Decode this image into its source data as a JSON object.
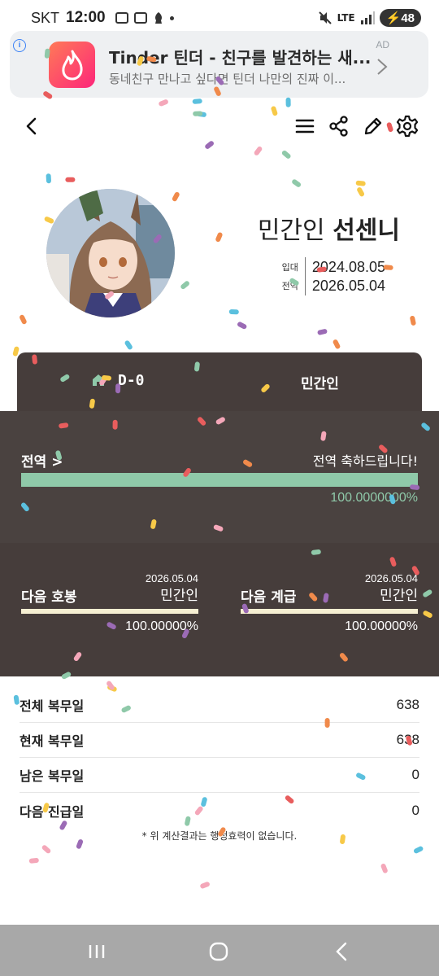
{
  "status_bar": {
    "carrier": "SKT",
    "time": "12:00",
    "network": "LTE",
    "battery": "48"
  },
  "ad": {
    "info_icon": "i",
    "app_name": "Tinder 틴더 - 친구를 발견하는 새...",
    "description": "동네친구 만나고 싶다면 틴더 나만의 진짜 이...",
    "tag": "AD",
    "brand_color": "#fd267a"
  },
  "toolbar": {
    "back_icon": "chevron-left-icon",
    "menu_icon": "menu-icon",
    "share_icon": "share-icon",
    "edit_icon": "pencil-icon",
    "settings_icon": "gear-icon"
  },
  "profile": {
    "name_prefix": "민간인",
    "name": "선센니",
    "enlist_label": "입대",
    "enlist_date": "2024.08.05",
    "discharge_label": "전역",
    "discharge_date": "2026.05.04"
  },
  "dday": {
    "icon": "home-icon",
    "text": "D-0",
    "rank": "민간인"
  },
  "discharge": {
    "label": "전역 >",
    "message": "전역 축하드립니다!",
    "progress": 1.0,
    "percent_text": "100.0000000%",
    "color": "#8fc9a9"
  },
  "promotion": {
    "next_pay": {
      "title": "다음 호봉",
      "date": "2026.05.04",
      "rank": "민간인",
      "progress": 1.0,
      "percent_text": "100.00000%"
    },
    "next_rank": {
      "title": "다음 계급",
      "date": "2026.05.04",
      "rank": "민간인",
      "progress": 1.0,
      "percent_text": "100.00000%"
    }
  },
  "stats": [
    {
      "label": "전체 복무일",
      "value": "638"
    },
    {
      "label": "현재 복무일",
      "value": "638"
    },
    {
      "label": "남은 복무일",
      "value": "0"
    },
    {
      "label": "다음 진급일",
      "value": "0"
    }
  ],
  "note": "* 위 계산결과는 행정효력이 없습니다.",
  "nav": {
    "recent_icon": "recent-apps-icon",
    "home_icon": "home-circle-icon",
    "back_icon": "back-icon"
  },
  "colors": {
    "panel_dark": "#463d3b",
    "panel_mid": "#4a4240",
    "accent_green": "#8fc9a9",
    "accent_cream": "#f6efd2",
    "confetti": [
      "#f4a7b9",
      "#e85d5d",
      "#f7c948",
      "#8fc9a9",
      "#5bc0de",
      "#9b6bb5",
      "#f08a4b"
    ]
  }
}
